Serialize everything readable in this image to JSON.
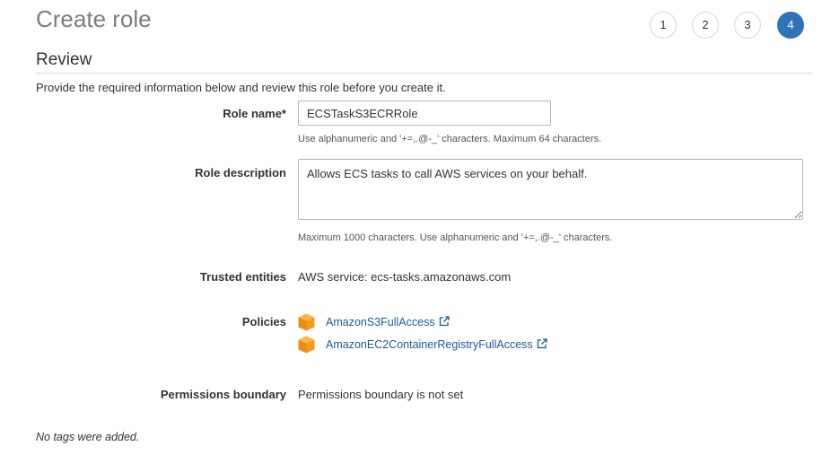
{
  "header": {
    "title": "Create role"
  },
  "steps": [
    {
      "label": "1",
      "active": false
    },
    {
      "label": "2",
      "active": false
    },
    {
      "label": "3",
      "active": false
    },
    {
      "label": "4",
      "active": true
    }
  ],
  "section": {
    "title": "Review",
    "intro": "Provide the required information below and review this role before you create it."
  },
  "form": {
    "role_name": {
      "label": "Role name*",
      "value": "ECSTaskS3ECRRole",
      "help": "Use alphanumeric and '+=,.@-_' characters. Maximum 64 characters."
    },
    "role_description": {
      "label": "Role description",
      "value": "Allows ECS tasks to call AWS services on your behalf.",
      "help": "Maximum 1000 characters. Use alphanumeric and '+=,.@-_' characters."
    },
    "trusted_entities": {
      "label": "Trusted entities",
      "value": "AWS service: ecs-tasks.amazonaws.com"
    },
    "policies": {
      "label": "Policies",
      "items": [
        {
          "name": "AmazonS3FullAccess",
          "icon": "policy-cube-icon"
        },
        {
          "name": "AmazonEC2ContainerRegistryFullAccess",
          "icon": "policy-cube-icon"
        }
      ]
    },
    "permissions_boundary": {
      "label": "Permissions boundary",
      "value": "Permissions boundary is not set"
    }
  },
  "footer": {
    "no_tags": "No tags were added."
  },
  "colors": {
    "accent": "#2e73b8",
    "link": "#1a5b9a",
    "policy_icon": "#f29c1f"
  }
}
